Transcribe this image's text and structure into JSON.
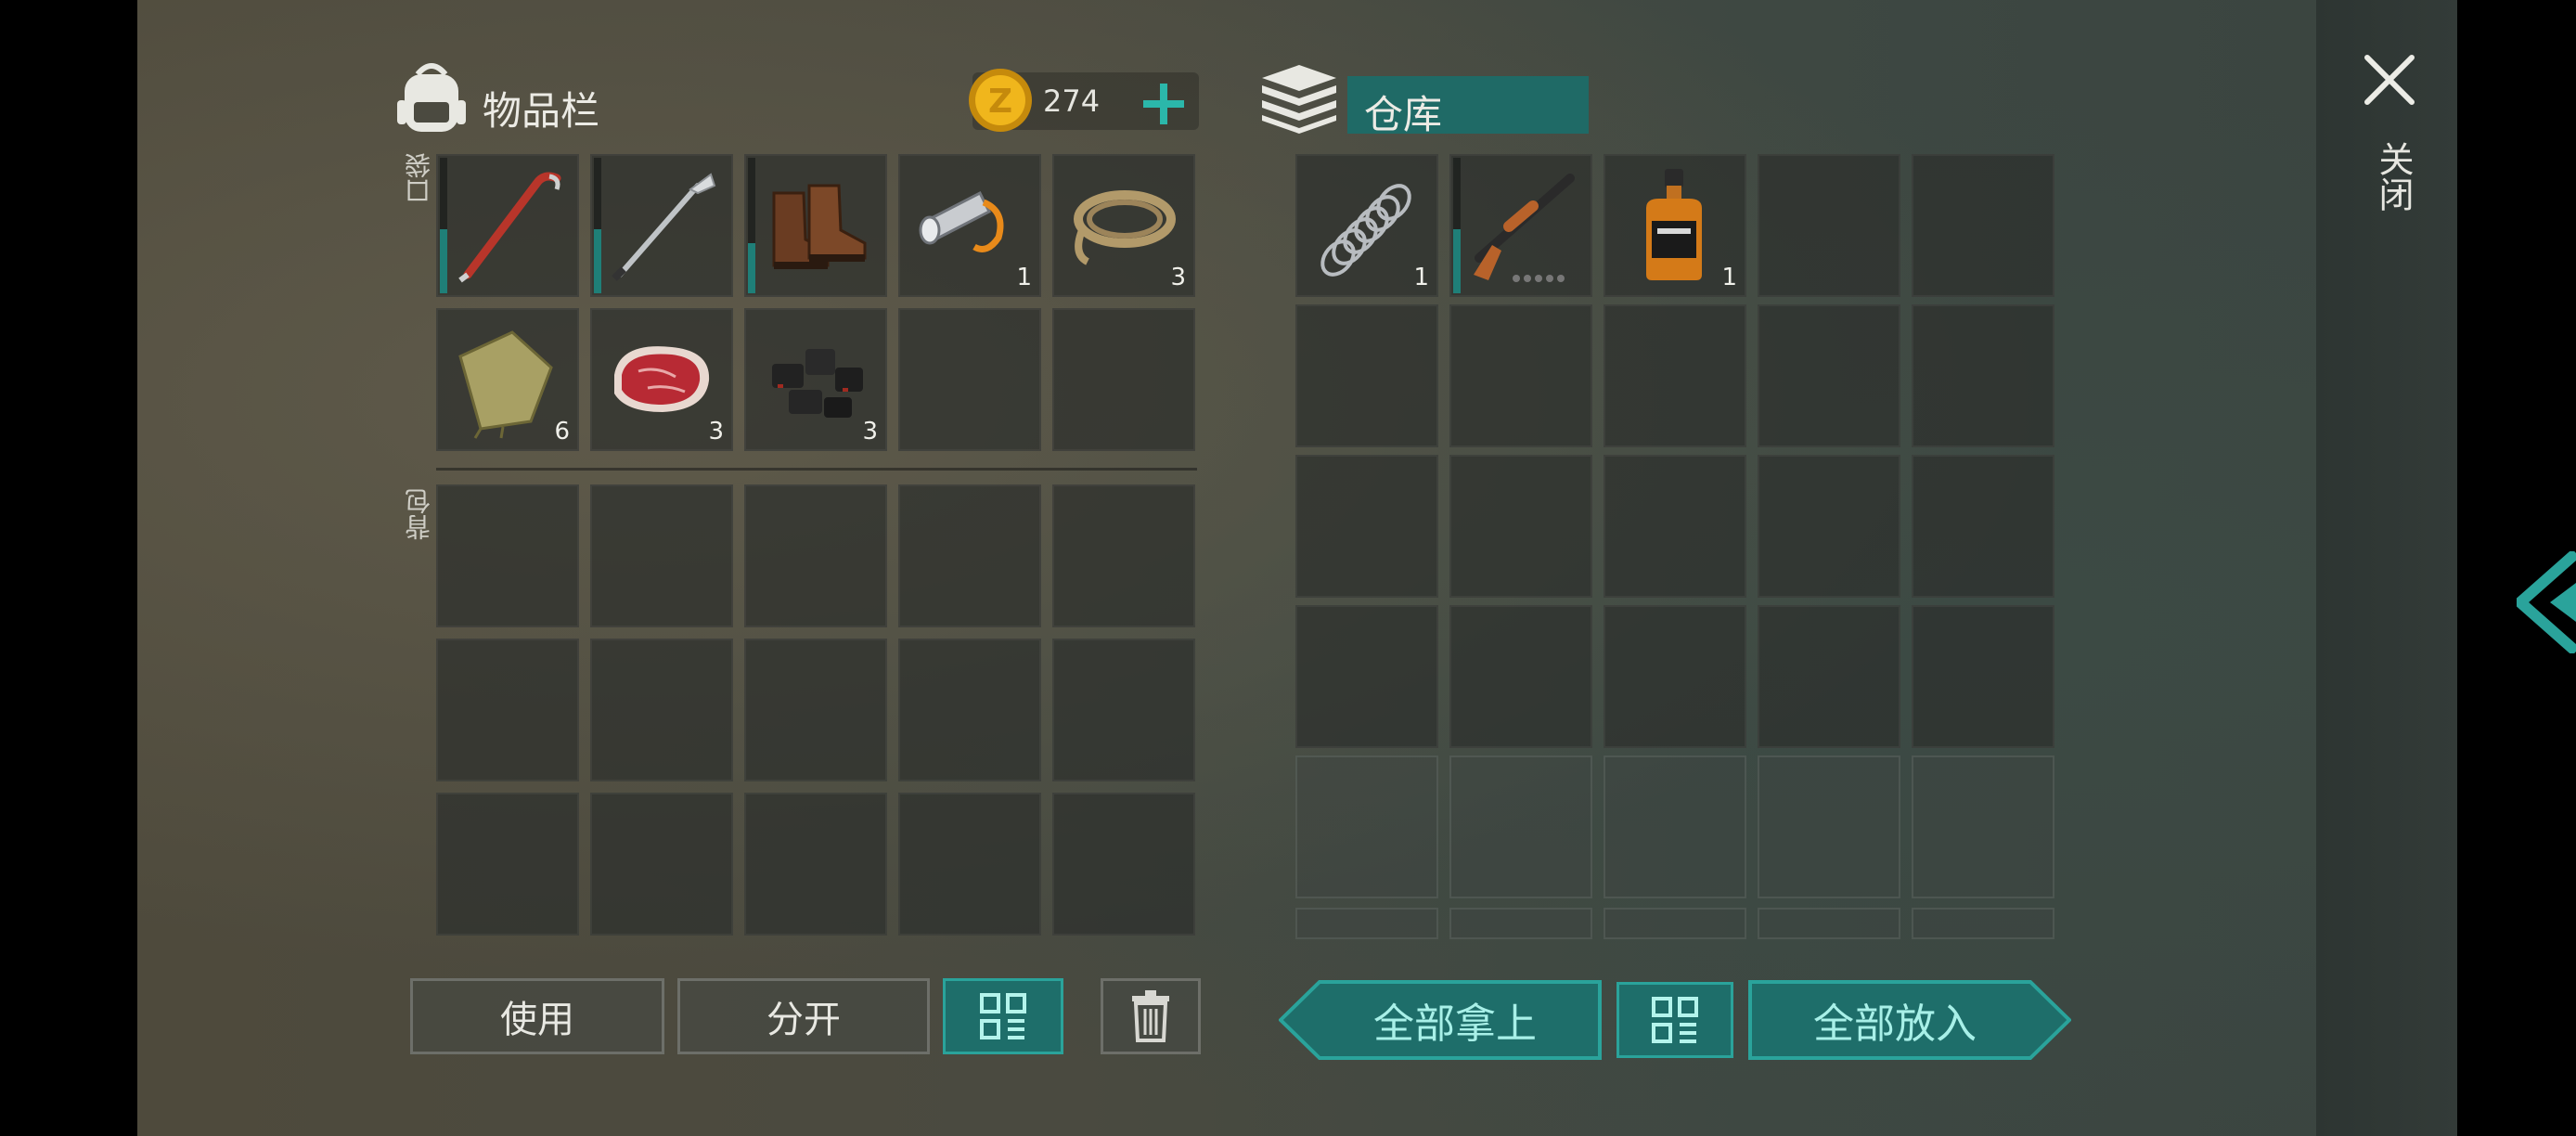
{
  "inventory": {
    "title": "物品栏",
    "coins": "274",
    "add_label": "+",
    "pocket_label": "口袋",
    "backpack_label": "背包",
    "pocket_items": [
      {
        "name": "crowbar",
        "count": "",
        "durability": 0.45
      },
      {
        "name": "golf-club",
        "count": "",
        "durability": 0.45
      },
      {
        "name": "boots",
        "count": "",
        "durability": 0.35
      },
      {
        "name": "flashlight",
        "count": "1"
      },
      {
        "name": "rope",
        "count": "3"
      },
      {
        "name": "cloth",
        "count": "6"
      },
      {
        "name": "raw-meat",
        "count": "3"
      },
      {
        "name": "coal",
        "count": "3"
      }
    ]
  },
  "storage": {
    "title": "仓库",
    "items": [
      {
        "name": "spring",
        "count": "1"
      },
      {
        "name": "shotgun",
        "count": "",
        "durability": 0.45
      },
      {
        "name": "whiskey",
        "count": "1"
      }
    ]
  },
  "buttons": {
    "use": "使用",
    "split": "分开",
    "take_all": "全部拿上",
    "put_all": "全部放入"
  },
  "close_label": "关闭",
  "colors": {
    "accent": "#1e6e6a",
    "accent_border": "#2aa39b",
    "durability": "#1f7f78",
    "coin": "#e0a814"
  }
}
